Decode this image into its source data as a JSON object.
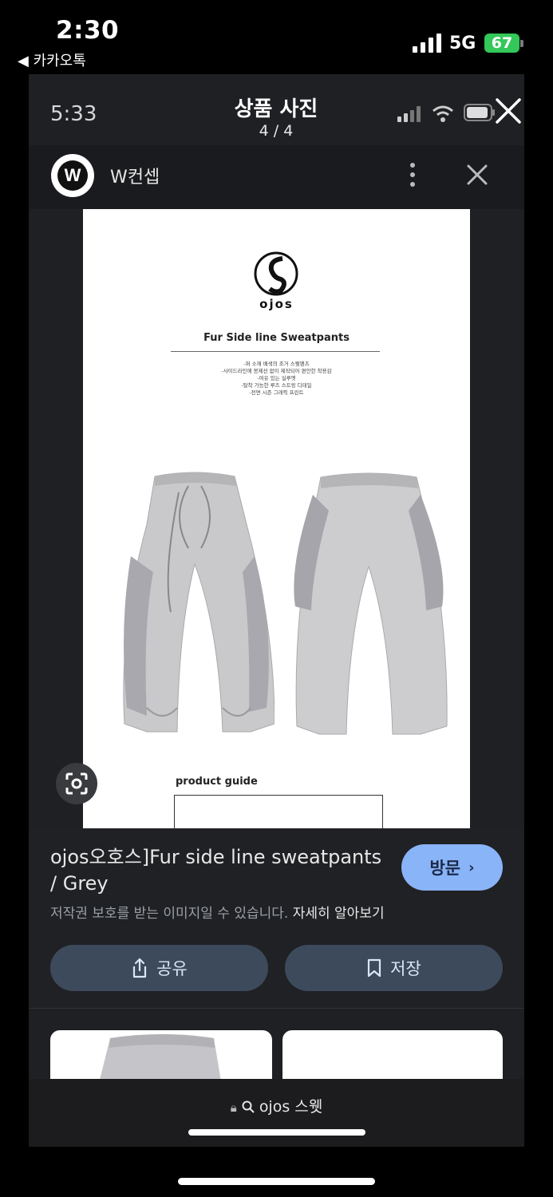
{
  "status_bar": {
    "time": "2:30",
    "back_label": "◀ 카카오톡",
    "network": "5G",
    "battery": "67"
  },
  "viewer": {
    "time": "5:33",
    "title": "상품 사진",
    "counter": "4 / 4"
  },
  "site": {
    "logo_letter": "W",
    "name": "W컨셉"
  },
  "product_image": {
    "brand": "ojos",
    "title": "Fur Side line Sweatpants",
    "description_lines": [
      "-퍼 소재 배색의 조거 스웻팬츠",
      "-사이드라인에 봉제선 없이 제작되어 편안한 착용감",
      "-여유 있는 실루엣",
      "-탈착 가능한 루즈 스트링 디테일",
      "-전면 시즌 그래픽 프린트"
    ],
    "guide_title": "product guide"
  },
  "info": {
    "product_title": "ojos오호스]Fur side line sweatpants / Grey",
    "visit_label": "방문",
    "copyright_text": "저작권 보호를 받는 이미지일 수 있습니다.",
    "learn_more": "자세히 알아보기",
    "share_label": "공유",
    "save_label": "저장"
  },
  "browser": {
    "url": "ojos 스웻"
  },
  "colors": {
    "accent": "#8ab4f8",
    "battery_green": "#34c759",
    "panel_bg": "#202124"
  }
}
